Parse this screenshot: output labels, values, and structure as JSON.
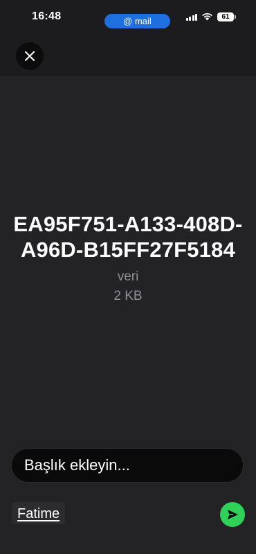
{
  "status_bar": {
    "time": "16:48",
    "indicator_label": "@ mail",
    "battery_level": "61"
  },
  "header": {
    "close_icon": "close-icon"
  },
  "file": {
    "name": "EA95F751-A133-408D-A96D-B15FF27F5184",
    "type_label": "veri",
    "size_label": "2 KB"
  },
  "caption": {
    "placeholder": "Başlık ekleyin..."
  },
  "recipient": {
    "name": "Fatime"
  },
  "send": {
    "icon": "send-icon",
    "color": "#30d158"
  }
}
